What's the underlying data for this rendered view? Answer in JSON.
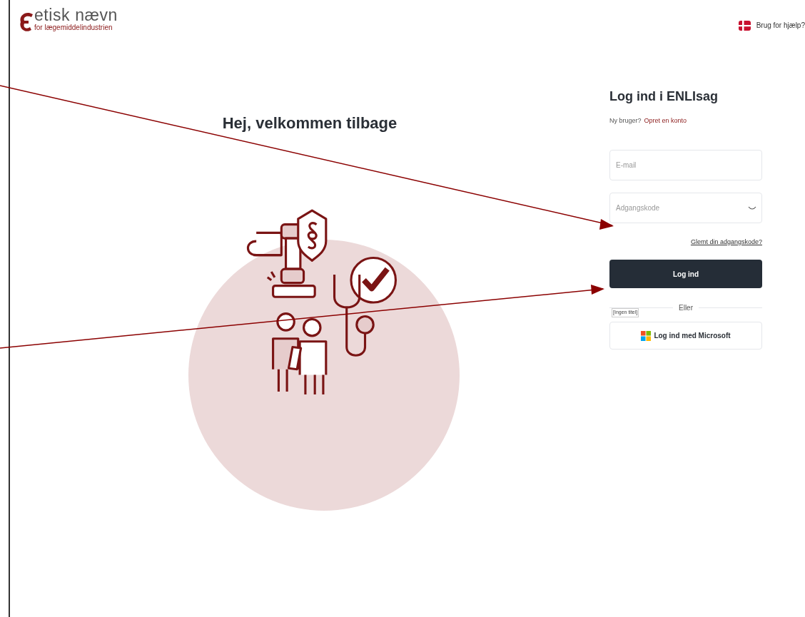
{
  "logo": {
    "name": "etisk nævn",
    "tagline": "for lægemiddelindustrien"
  },
  "help": {
    "label": "Brug for hjælp?"
  },
  "welcome": {
    "title": "Hej, velkommen tilbage"
  },
  "login": {
    "title": "Log ind i ENLIsag",
    "new_user": "Ny bruger?",
    "create_account": "Opret en konto",
    "email": {
      "placeholder": "E-mail"
    },
    "password": {
      "placeholder": "Adgangskode"
    },
    "forgot": "Glemt din adgangskode?",
    "submit": "Log ind",
    "divider": "Eller",
    "tooltip": "[Ingen titel]",
    "microsoft": "Log ind med Microsoft"
  }
}
